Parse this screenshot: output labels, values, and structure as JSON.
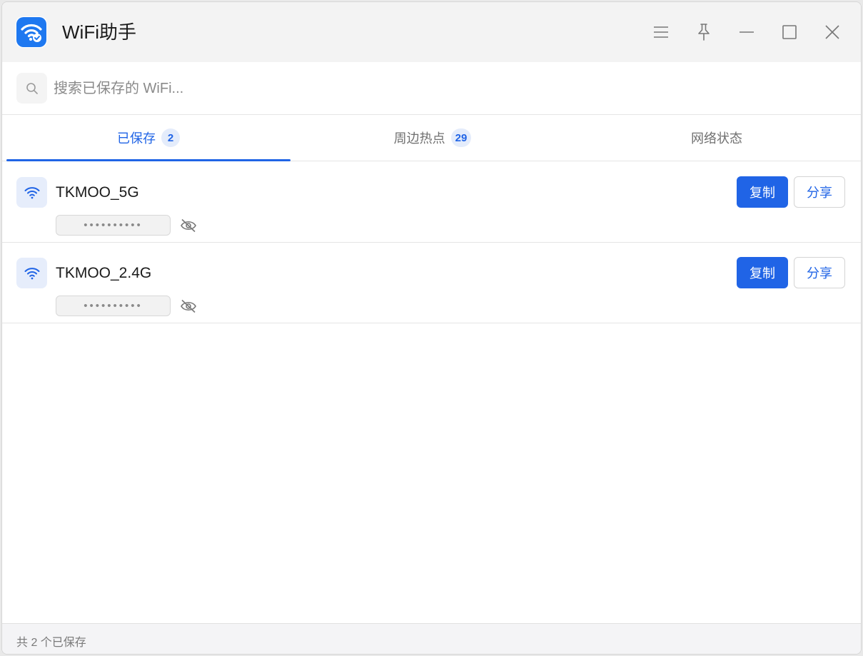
{
  "app": {
    "title": "WiFi助手",
    "accent_color": "#2064e6",
    "logo_icon": "wifi-check-icon"
  },
  "window_controls": [
    {
      "name": "menu-icon"
    },
    {
      "name": "pin-icon"
    },
    {
      "name": "minimize-icon"
    },
    {
      "name": "maximize-icon"
    },
    {
      "name": "close-icon"
    }
  ],
  "search": {
    "placeholder": "搜索已保存的 WiFi...",
    "value": ""
  },
  "tabs": [
    {
      "label": "已保存",
      "badge": "2",
      "active": true
    },
    {
      "label": "周边热点",
      "badge": "29",
      "active": false
    },
    {
      "label": "网络状态",
      "badge": "",
      "active": false
    }
  ],
  "networks": [
    {
      "ssid": "TKMOO_5G",
      "password_masked": "••••••••••",
      "copy_label": "复制",
      "share_label": "分享"
    },
    {
      "ssid": "TKMOO_2.4G",
      "password_masked": "••••••••••",
      "copy_label": "复制",
      "share_label": "分享"
    }
  ],
  "status": {
    "text": "共 2 个已保存"
  }
}
